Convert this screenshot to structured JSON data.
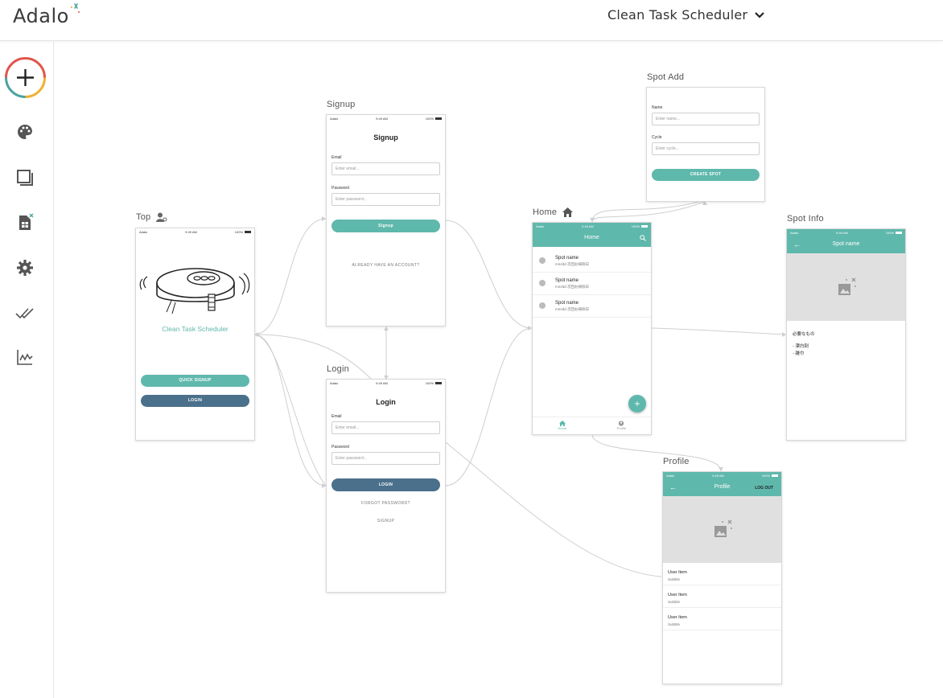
{
  "brand": {
    "logo_text": "Adalo",
    "accent_teal": "#5fb8ac",
    "accent_navy": "#4a708b"
  },
  "header": {
    "app_title": "Clean Task Scheduler",
    "menu_icon": "chevron-down-icon"
  },
  "sidebar": {
    "items": [
      {
        "icon": "add-icon"
      },
      {
        "icon": "palette-icon"
      },
      {
        "icon": "screens-icon"
      },
      {
        "icon": "database-icon"
      },
      {
        "icon": "gear-icon"
      },
      {
        "icon": "publish-check-icon"
      },
      {
        "icon": "analytics-icon"
      }
    ]
  },
  "screens": {
    "top": {
      "label": "Top",
      "status": {
        "carrier": "Adalo",
        "time": "9:49 AM",
        "battery": "100%"
      },
      "app_name": "Clean Task Scheduler",
      "quick_signup": "QUICK SIGNUP",
      "login": "LOGIN"
    },
    "signup": {
      "label": "Signup",
      "status": {
        "carrier": "Adalo",
        "time": "9:49 AM",
        "battery": "100%"
      },
      "title": "Signup",
      "email_label": "Email",
      "email_placeholder": "Enter email...",
      "password_label": "Password",
      "password_placeholder": "Enter password...",
      "button": "Signup",
      "already": "ALREADY HAVE AN ACCOUNT?"
    },
    "login": {
      "label": "Login",
      "status": {
        "carrier": "Adalo",
        "time": "9:49 AM",
        "battery": "100%"
      },
      "title": "Login",
      "email_label": "Email",
      "email_placeholder": "Enter email...",
      "password_label": "Password",
      "password_placeholder": "Enter password...",
      "button": "LOGIN",
      "forgot": "FORGOT PASSWORD?",
      "signup": "SIGNUP"
    },
    "home": {
      "label": "Home",
      "status": {
        "carrier": "Adalo",
        "time": "9:49 AM",
        "battery": "100%"
      },
      "title": "Home",
      "items": [
        {
          "name": "Spot name",
          "sub": "mm/dd 次回お掃除日"
        },
        {
          "name": "Spot name",
          "sub": "mm/dd 次回お掃除日"
        },
        {
          "name": "Spot name",
          "sub": "mm/dd 次回お掃除日"
        }
      ],
      "tab_home": "Home",
      "tab_profile": "Profile"
    },
    "spot_add": {
      "label": "Spot Add",
      "name_label": "Name",
      "name_placeholder": "Enter name...",
      "cycle_label": "Cycle",
      "cycle_placeholder": "Enter cycle...",
      "button": "CREATE SPOT"
    },
    "spot_info": {
      "label": "Spot Info",
      "status": {
        "carrier": "Adalo",
        "time": "9:49 AM",
        "battery": "100%"
      },
      "title": "Spot name",
      "needs": "必要なもの",
      "item1": "- 漂白剤",
      "item2": "- 雑巾"
    },
    "profile": {
      "label": "Profile",
      "status": {
        "carrier": "Adalo",
        "time": "9:49 AM",
        "battery": "100%"
      },
      "title": "Profile",
      "logout": "LOG OUT",
      "items": [
        {
          "title": "User Item",
          "sub": "Subtitle"
        },
        {
          "title": "User Item",
          "sub": "Subtitle"
        },
        {
          "title": "User Item",
          "sub": "Subtitle"
        }
      ]
    }
  }
}
